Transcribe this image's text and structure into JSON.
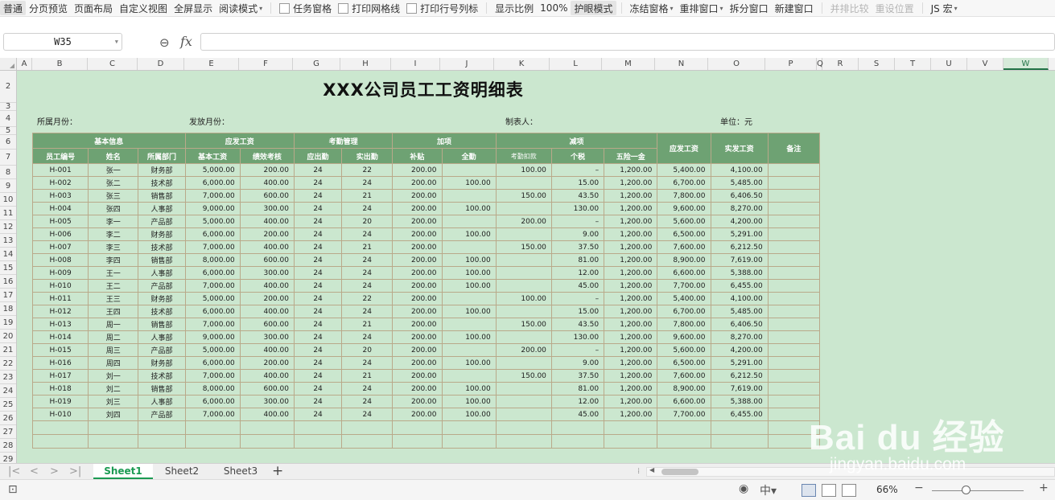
{
  "toolbar": {
    "items": [
      {
        "label": "普通",
        "active": true
      },
      {
        "label": "分页预览"
      },
      {
        "label": "页面布局"
      },
      {
        "label": "自定义视图"
      },
      {
        "label": "全屏显示"
      },
      {
        "label": "阅读模式",
        "dropdown": true
      },
      {
        "label": "任务窗格",
        "checkbox": true
      },
      {
        "label": "打印网格线",
        "checkbox": true
      },
      {
        "label": "打印行号列标",
        "checkbox": true
      },
      {
        "label": "显示比例"
      },
      {
        "label": "100%"
      },
      {
        "label": "护眼模式",
        "active": true
      },
      {
        "label": "冻结窗格",
        "dropdown": true
      },
      {
        "label": "重排窗口",
        "dropdown": true
      },
      {
        "label": "拆分窗口"
      },
      {
        "label": "新建窗口"
      },
      {
        "label": "并排比较",
        "disabled": true
      },
      {
        "label": "重设位置",
        "disabled": true
      },
      {
        "label": "JS 宏",
        "dropdown": true
      }
    ]
  },
  "formula_bar": {
    "name_box": "W35",
    "fx": "fx",
    "formula": ""
  },
  "columns": [
    "A",
    "B",
    "C",
    "D",
    "E",
    "F",
    "G",
    "H",
    "I",
    "J",
    "K",
    "L",
    "M",
    "N",
    "O",
    "P",
    "Q",
    "R",
    "S",
    "T",
    "U",
    "V",
    "W"
  ],
  "selected_column": "W",
  "rows": [
    "2",
    "3",
    "4",
    "5",
    "6",
    "7",
    "8",
    "9",
    "10",
    "11",
    "12",
    "13",
    "14",
    "15",
    "16",
    "17",
    "18",
    "19",
    "20",
    "21",
    "22",
    "23",
    "24",
    "25",
    "26",
    "27",
    "28",
    "29"
  ],
  "sheet": {
    "title": "XXX公司员工工资明细表",
    "month_label": "所属月份：",
    "pay_month_label": "发放月份：",
    "maker_label": "制表人：",
    "unit_label": "单位：元"
  },
  "table": {
    "group_headers": [
      "基本信息",
      "应发工资",
      "考勤管理",
      "加项",
      "减项",
      "应发工资",
      "实发工资",
      "备注"
    ],
    "sub_headers": [
      "员工编号",
      "姓名",
      "所属部门",
      "基本工资",
      "绩效考核",
      "应出勤",
      "实出勤",
      "补贴",
      "全勤",
      "考勤扣款",
      "个税",
      "五险一金"
    ],
    "rows": [
      [
        "H-001",
        "张一",
        "财务部",
        "5,000.00",
        "200.00",
        "24",
        "22",
        "200.00",
        "",
        "100.00",
        "–",
        "1,200.00",
        "5,400.00",
        "4,100.00",
        ""
      ],
      [
        "H-002",
        "张二",
        "技术部",
        "6,000.00",
        "400.00",
        "24",
        "24",
        "200.00",
        "100.00",
        "",
        "15.00",
        "1,200.00",
        "6,700.00",
        "5,485.00",
        ""
      ],
      [
        "H-003",
        "张三",
        "销售部",
        "7,000.00",
        "600.00",
        "24",
        "21",
        "200.00",
        "",
        "150.00",
        "43.50",
        "1,200.00",
        "7,800.00",
        "6,406.50",
        ""
      ],
      [
        "H-004",
        "张四",
        "人事部",
        "9,000.00",
        "300.00",
        "24",
        "24",
        "200.00",
        "100.00",
        "",
        "130.00",
        "1,200.00",
        "9,600.00",
        "8,270.00",
        ""
      ],
      [
        "H-005",
        "李一",
        "产品部",
        "5,000.00",
        "400.00",
        "24",
        "20",
        "200.00",
        "",
        "200.00",
        "–",
        "1,200.00",
        "5,600.00",
        "4,200.00",
        ""
      ],
      [
        "H-006",
        "李二",
        "财务部",
        "6,000.00",
        "200.00",
        "24",
        "24",
        "200.00",
        "100.00",
        "",
        "9.00",
        "1,200.00",
        "6,500.00",
        "5,291.00",
        ""
      ],
      [
        "H-007",
        "李三",
        "技术部",
        "7,000.00",
        "400.00",
        "24",
        "21",
        "200.00",
        "",
        "150.00",
        "37.50",
        "1,200.00",
        "7,600.00",
        "6,212.50",
        ""
      ],
      [
        "H-008",
        "李四",
        "销售部",
        "8,000.00",
        "600.00",
        "24",
        "24",
        "200.00",
        "100.00",
        "",
        "81.00",
        "1,200.00",
        "8,900.00",
        "7,619.00",
        ""
      ],
      [
        "H-009",
        "王一",
        "人事部",
        "6,000.00",
        "300.00",
        "24",
        "24",
        "200.00",
        "100.00",
        "",
        "12.00",
        "1,200.00",
        "6,600.00",
        "5,388.00",
        ""
      ],
      [
        "H-010",
        "王二",
        "产品部",
        "7,000.00",
        "400.00",
        "24",
        "24",
        "200.00",
        "100.00",
        "",
        "45.00",
        "1,200.00",
        "7,700.00",
        "6,455.00",
        ""
      ],
      [
        "H-011",
        "王三",
        "财务部",
        "5,000.00",
        "200.00",
        "24",
        "22",
        "200.00",
        "",
        "100.00",
        "–",
        "1,200.00",
        "5,400.00",
        "4,100.00",
        ""
      ],
      [
        "H-012",
        "王四",
        "技术部",
        "6,000.00",
        "400.00",
        "24",
        "24",
        "200.00",
        "100.00",
        "",
        "15.00",
        "1,200.00",
        "6,700.00",
        "5,485.00",
        ""
      ],
      [
        "H-013",
        "周一",
        "销售部",
        "7,000.00",
        "600.00",
        "24",
        "21",
        "200.00",
        "",
        "150.00",
        "43.50",
        "1,200.00",
        "7,800.00",
        "6,406.50",
        ""
      ],
      [
        "H-014",
        "周二",
        "人事部",
        "9,000.00",
        "300.00",
        "24",
        "24",
        "200.00",
        "100.00",
        "",
        "130.00",
        "1,200.00",
        "9,600.00",
        "8,270.00",
        ""
      ],
      [
        "H-015",
        "周三",
        "产品部",
        "5,000.00",
        "400.00",
        "24",
        "20",
        "200.00",
        "",
        "200.00",
        "–",
        "1,200.00",
        "5,600.00",
        "4,200.00",
        ""
      ],
      [
        "H-016",
        "周四",
        "财务部",
        "6,000.00",
        "200.00",
        "24",
        "24",
        "200.00",
        "100.00",
        "",
        "9.00",
        "1,200.00",
        "6,500.00",
        "5,291.00",
        ""
      ],
      [
        "H-017",
        "刘一",
        "技术部",
        "7,000.00",
        "400.00",
        "24",
        "21",
        "200.00",
        "",
        "150.00",
        "37.50",
        "1,200.00",
        "7,600.00",
        "6,212.50",
        ""
      ],
      [
        "H-018",
        "刘二",
        "销售部",
        "8,000.00",
        "600.00",
        "24",
        "24",
        "200.00",
        "100.00",
        "",
        "81.00",
        "1,200.00",
        "8,900.00",
        "7,619.00",
        ""
      ],
      [
        "H-019",
        "刘三",
        "人事部",
        "6,000.00",
        "300.00",
        "24",
        "24",
        "200.00",
        "100.00",
        "",
        "12.00",
        "1,200.00",
        "6,600.00",
        "5,388.00",
        ""
      ],
      [
        "H-010",
        "刘四",
        "产品部",
        "7,000.00",
        "400.00",
        "24",
        "24",
        "200.00",
        "100.00",
        "",
        "45.00",
        "1,200.00",
        "7,700.00",
        "6,455.00",
        ""
      ]
    ]
  },
  "tabs": {
    "sheets": [
      {
        "label": "Sheet1",
        "active": true
      },
      {
        "label": "Sheet2"
      },
      {
        "label": "Sheet3"
      }
    ],
    "add": "+"
  },
  "status": {
    "zoom": "66%"
  },
  "watermark": {
    "brand": "Bai du 经验",
    "url": "jingyan.baidu.com"
  },
  "colors": {
    "sheet_bg": "#cbe7cf",
    "header_fill": "#6ea273",
    "active_tab": "#1b9a52"
  }
}
